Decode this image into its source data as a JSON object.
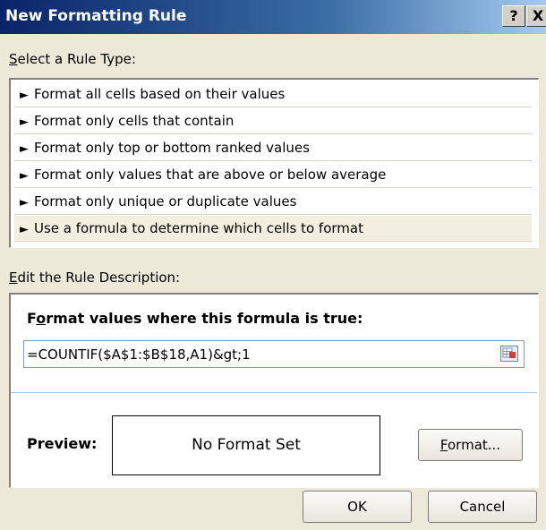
{
  "window": {
    "title": "New Formatting Rule",
    "help_label": "?",
    "close_label": "X"
  },
  "select_rule_type": {
    "label_mnemonic": "S",
    "label_rest": "elect a Rule Type:",
    "arrow": "►",
    "selected_index": 5,
    "items": [
      {
        "label": "Format all cells based on their values"
      },
      {
        "label": "Format only cells that contain"
      },
      {
        "label": "Format only top or bottom ranked values"
      },
      {
        "label": "Format only values that are above or below average"
      },
      {
        "label": "Format only unique or duplicate values"
      },
      {
        "label": "Use a formula to determine which cells to format"
      }
    ]
  },
  "edit_rule": {
    "label_mnemonic": "E",
    "label_rest": "dit the Rule Description:",
    "heading_pre": "F",
    "heading_mnemonic": "o",
    "heading_rest": "rmat values where this formula is true:",
    "formula_value": "=COUNTIF($A$1:$B$18,A1)&gt;1"
  },
  "preview": {
    "label": "Preview:",
    "text": "No Format Set"
  },
  "buttons": {
    "format_mnemonic": "F",
    "format_rest": "ormat...",
    "ok": "OK",
    "cancel": "Cancel"
  }
}
